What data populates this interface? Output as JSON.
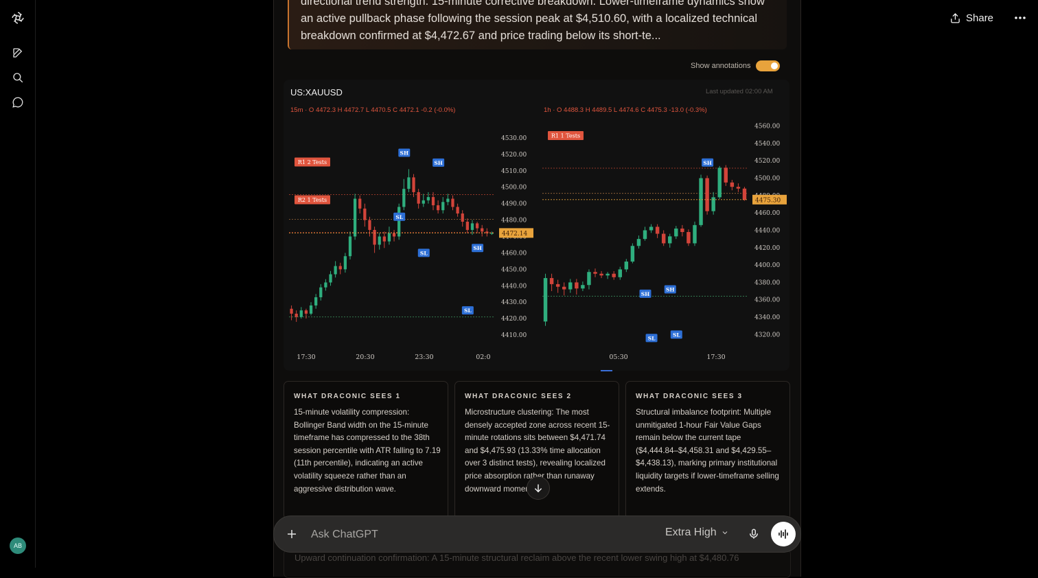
{
  "topbar": {
    "share_label": "Share"
  },
  "summary": {
    "lines": [
      "directional trend strength. 15-minute corrective breakdown. Lower-timeframe dynamics show",
      "an active pullback phase following the session peak at $4,510.60, with a localized technical",
      "breakdown confirmed at $4,472.67 and price trading below its short-te..."
    ]
  },
  "annotations": {
    "label": "Show annotations",
    "enabled": true
  },
  "chart": {
    "symbol": "US:XAUUSD",
    "last_updated": "Last updated 02:00 AM",
    "left_ohlc": "15m · O 4472.3 H 4472.7 L 4470.5 C 4472.1 -0.2 (-0.0%)",
    "right_ohlc": "1h · O 4488.3 H 4489.5 L 4474.6 C 4475.3 -13.0 (-0.3%)"
  },
  "chart_data": [
    {
      "type": "candlestick",
      "title": "15m",
      "yticks": [
        "4530.00",
        "4520.00",
        "4510.00",
        "4500.00",
        "4490.00",
        "4480.00",
        "4470.00",
        "4460.00",
        "4450.00",
        "4440.00",
        "4430.00",
        "4420.00",
        "4410.00"
      ],
      "xticks": [
        "17:30",
        "20:30",
        "23:30",
        "02:0"
      ],
      "ylim": [
        4405,
        4535
      ],
      "price_label": "4472.14",
      "price": 4472.14,
      "levels": [
        {
          "label": "R1 2 Tests",
          "price": 4495.5
        },
        {
          "label": "R2 1 Tests",
          "price": 4472.5
        }
      ],
      "extra_levels": [
        4480.5,
        4421.0
      ],
      "markers": [
        {
          "label": "SH",
          "price": 4521,
          "i": 23
        },
        {
          "label": "SH",
          "price": 4515,
          "i": 30
        },
        {
          "label": "SL",
          "price": 4482,
          "i": 22
        },
        {
          "label": "SL",
          "price": 4460,
          "i": 27
        },
        {
          "label": "SH",
          "price": 4463,
          "i": 38
        },
        {
          "label": "SL",
          "price": 4425,
          "i": 36
        }
      ],
      "candles": [
        [
          4426,
          4423,
          4428,
          4419
        ],
        [
          4423,
          4421,
          4425,
          4418
        ],
        [
          4421,
          4425,
          4427,
          4420
        ],
        [
          4425,
          4423,
          4426,
          4420
        ],
        [
          4423,
          4428,
          4430,
          4422
        ],
        [
          4428,
          4433,
          4435,
          4426
        ],
        [
          4433,
          4439,
          4441,
          4431
        ],
        [
          4439,
          4442,
          4444,
          4437
        ],
        [
          4442,
          4447,
          4449,
          4440
        ],
        [
          4447,
          4452,
          4455,
          4445
        ],
        [
          4452,
          4450,
          4454,
          4447
        ],
        [
          4450,
          4458,
          4460,
          4448
        ],
        [
          4458,
          4470,
          4473,
          4456
        ],
        [
          4470,
          4493,
          4496,
          4468
        ],
        [
          4493,
          4487,
          4495,
          4484
        ],
        [
          4487,
          4480,
          4490,
          4476
        ],
        [
          4480,
          4474,
          4482,
          4470
        ],
        [
          4474,
          4465,
          4476,
          4460
        ],
        [
          4465,
          4470,
          4472,
          4462
        ],
        [
          4470,
          4467,
          4473,
          4463
        ],
        [
          4467,
          4472,
          4476,
          4465
        ],
        [
          4472,
          4470,
          4474,
          4467
        ],
        [
          4470,
          4488,
          4490,
          4468
        ],
        [
          4488,
          4499,
          4505,
          4486
        ],
        [
          4499,
          4506,
          4511,
          4497
        ],
        [
          4506,
          4497,
          4508,
          4494
        ],
        [
          4497,
          4490,
          4499,
          4487
        ],
        [
          4490,
          4492,
          4496,
          4488
        ],
        [
          4492,
          4494,
          4497,
          4490
        ],
        [
          4494,
          4489,
          4497,
          4486
        ],
        [
          4489,
          4486,
          4492,
          4484
        ],
        [
          4486,
          4491,
          4494,
          4484
        ],
        [
          4491,
          4493,
          4496,
          4489
        ],
        [
          4493,
          4488,
          4495,
          4486
        ],
        [
          4488,
          4484,
          4490,
          4482
        ],
        [
          4484,
          4479,
          4486,
          4476
        ],
        [
          4479,
          4474,
          4481,
          4472
        ],
        [
          4474,
          4478,
          4480,
          4471
        ],
        [
          4478,
          4475,
          4479,
          4472
        ],
        [
          4475,
          4473,
          4477,
          4470
        ],
        [
          4473,
          4472,
          4475,
          4470
        ],
        [
          4472,
          4472,
          4473,
          4471
        ]
      ]
    },
    {
      "type": "candlestick",
      "title": "1h",
      "yticks": [
        "4560.00",
        "4540.00",
        "4520.00",
        "4500.00",
        "4480.00",
        "4460.00",
        "4440.00",
        "4420.00",
        "4400.00",
        "4380.00",
        "4360.00",
        "4340.00",
        "4320.00"
      ],
      "xticks": [
        "05:30",
        "17:30"
      ],
      "ylim": [
        4310,
        4566
      ],
      "price_label": "4475.30",
      "price": 4475.3,
      "levels": [
        {
          "label": "R1 1 Tests",
          "price": 4511.5
        }
      ],
      "extra_levels": [
        4482.5,
        4364.0
      ],
      "markers": [
        {
          "label": "SH",
          "price": 4518,
          "i": 26
        },
        {
          "label": "SH",
          "price": 4372,
          "i": 20
        },
        {
          "label": "SH",
          "price": 4367,
          "i": 16
        },
        {
          "label": "SL",
          "price": 4316,
          "i": 17
        },
        {
          "label": "SL",
          "price": 4320,
          "i": 21
        }
      ],
      "candles": [
        [
          4335,
          4385,
          4390,
          4330
        ],
        [
          4385,
          4378,
          4390,
          4370
        ],
        [
          4378,
          4375,
          4383,
          4368
        ],
        [
          4375,
          4372,
          4380,
          4365
        ],
        [
          4372,
          4380,
          4384,
          4368
        ],
        [
          4380,
          4373,
          4384,
          4366
        ],
        [
          4373,
          4377,
          4381,
          4370
        ],
        [
          4377,
          4392,
          4395,
          4372
        ],
        [
          4392,
          4390,
          4396,
          4386
        ],
        [
          4390,
          4388,
          4393,
          4385
        ],
        [
          4388,
          4390,
          4392,
          4384
        ],
        [
          4390,
          4386,
          4393,
          4383
        ],
        [
          4386,
          4395,
          4398,
          4383
        ],
        [
          4395,
          4404,
          4407,
          4392
        ],
        [
          4404,
          4422,
          4425,
          4402
        ],
        [
          4422,
          4430,
          4434,
          4419
        ],
        [
          4430,
          4440,
          4444,
          4428
        ],
        [
          4440,
          4444,
          4447,
          4437
        ],
        [
          4444,
          4436,
          4447,
          4431
        ],
        [
          4436,
          4425,
          4440,
          4422
        ],
        [
          4425,
          4433,
          4436,
          4420
        ],
        [
          4433,
          4442,
          4445,
          4430
        ],
        [
          4442,
          4438,
          4446,
          4433
        ],
        [
          4438,
          4425,
          4441,
          4422
        ],
        [
          4425,
          4446,
          4450,
          4422
        ],
        [
          4446,
          4500,
          4504,
          4444
        ],
        [
          4500,
          4462,
          4503,
          4458
        ],
        [
          4462,
          4478,
          4484,
          4458
        ],
        [
          4478,
          4512,
          4514,
          4476
        ],
        [
          4512,
          4495,
          4515,
          4491
        ],
        [
          4495,
          4490,
          4498,
          4486
        ],
        [
          4490,
          4488,
          4494,
          4484
        ],
        [
          4488,
          4475,
          4490,
          4474
        ]
      ]
    }
  ],
  "tiles": [
    {
      "heading": "WHAT DRACONIC SEES 1",
      "body": "15-minute volatility compression: Bollinger Band width on the 15-minute timeframe has compressed to the 38th session percentile with ATR falling to 7.19 (11th percentile), indicating an active volatility squeeze rather than an aggressive distribution wave."
    },
    {
      "heading": "WHAT DRACONIC SEES 2",
      "body": "Microstructure clustering: The most densely accepted zone across recent 15-minute rotations sits between $4,471.74 and $4,475.93 (13.33% time allocation over 3 distinct tests), revealing localized price absorption rather than runaway downward momentum."
    },
    {
      "heading": "WHAT DRACONIC SEES 3",
      "body": "Structural imbalance footprint: Multiple unmitigated 1-hour Fair Value Gaps remain below the current tape ($4,444.84–$4,458.31 and $4,429.55–$4,438.13), marking primary institutional liquidity targets if lower-timeframe selling extends."
    }
  ],
  "composer": {
    "placeholder": "Ask ChatGPT",
    "model": "Extra High"
  },
  "bottom_text": "Upward continuation confirmation: A 15-minute structural reclaim above the recent lower swing high at $4,480.76",
  "avatar": {
    "initials": "AB"
  },
  "colors": {
    "bull": "#2fae7e",
    "bear": "#d2443a",
    "accent": "#e8a33c",
    "marker": "#2d6fd6"
  }
}
